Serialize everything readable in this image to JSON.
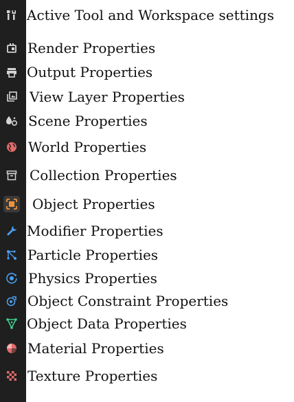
{
  "items": [
    {
      "label": "Active Tool and Workspace settings",
      "icon": "tool-workspace-icon",
      "color": "#d4d4d4"
    },
    {
      "label": "Render Properties",
      "icon": "render-camera-icon",
      "color": "#d4d4d4"
    },
    {
      "label": "Output Properties",
      "icon": "output-printer-icon",
      "color": "#d4d4d4"
    },
    {
      "label": "View Layer Properties",
      "icon": "view-layer-icon",
      "color": "#d4d4d4"
    },
    {
      "label": "Scene Properties",
      "icon": "scene-icon",
      "color": "#d4d4d4"
    },
    {
      "label": "World Properties",
      "icon": "world-globe-icon",
      "color": "#e06a6a"
    },
    {
      "label": "Collection Properties",
      "icon": "collection-box-icon",
      "color": "#d4d4d4"
    },
    {
      "label": "Object Properties",
      "icon": "object-square-icon",
      "color": "#f0913a"
    },
    {
      "label": "Modifier Properties",
      "icon": "modifier-wrench-icon",
      "color": "#4a9ff0"
    },
    {
      "label": "Particle Properties",
      "icon": "particles-icon",
      "color": "#4a9ff0"
    },
    {
      "label": "Physics Properties",
      "icon": "physics-orbit-icon",
      "color": "#4a9ff0"
    },
    {
      "label": "Object Constraint Properties",
      "icon": "constraint-link-icon",
      "color": "#4a9ff0"
    },
    {
      "label": "Object Data Properties",
      "icon": "object-data-vertex-icon",
      "color": "#3fcf8e"
    },
    {
      "label": "Material Properties",
      "icon": "material-sphere-icon",
      "color": "#e06a6a"
    },
    {
      "label": "Texture Properties",
      "icon": "texture-checker-icon",
      "color": "#e06a6a"
    }
  ]
}
